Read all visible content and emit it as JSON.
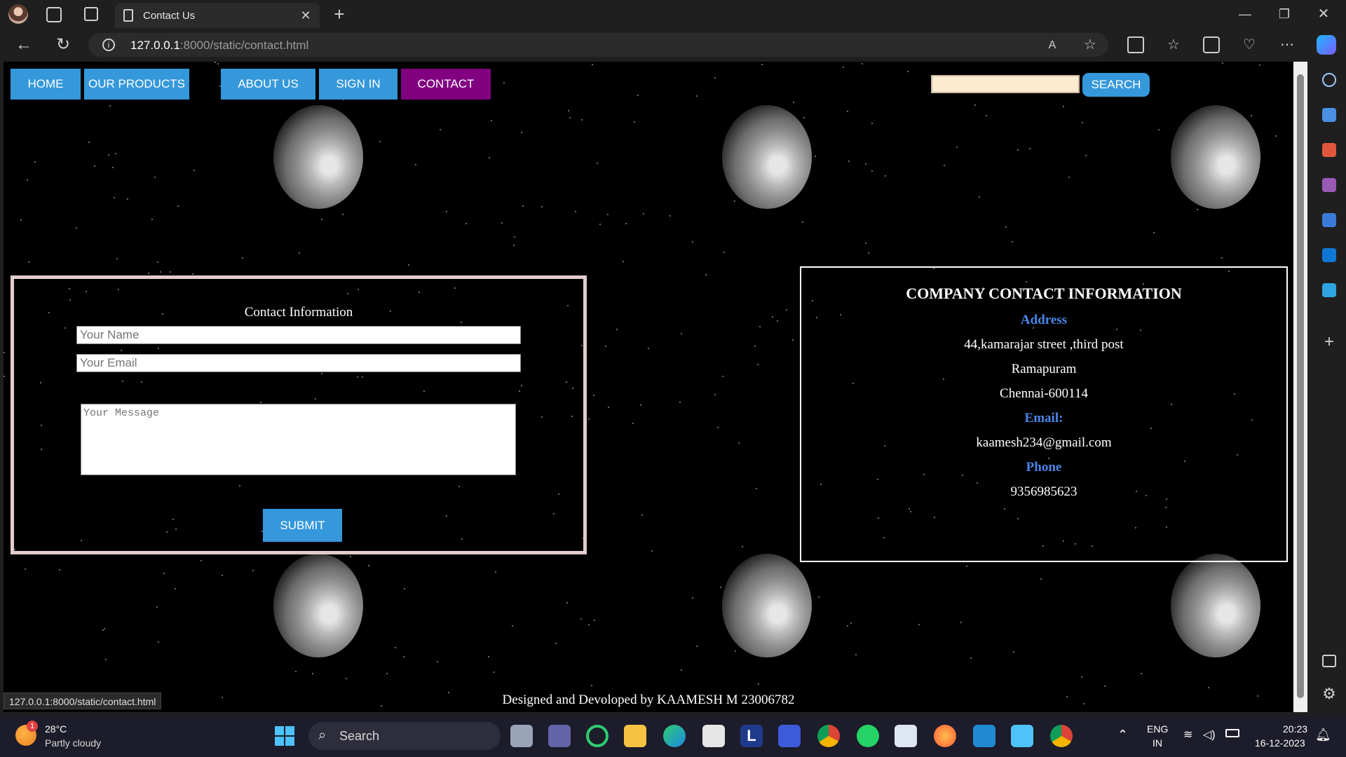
{
  "browser": {
    "tab_title": "Contact Us",
    "url_host": "127.0.0.1",
    "url_path": ":8000/static/contact.html",
    "status_url": "127.0.0.1:8000/static/contact.html"
  },
  "nav": {
    "items": [
      "HOME",
      "OUR PRODUCTS",
      "ABOUT US",
      "SIGN IN",
      "CONTACT"
    ],
    "active": "CONTACT",
    "search_label": "SEARCH"
  },
  "form": {
    "title": "Contact Information",
    "name_placeholder": "Your Name",
    "email_placeholder": "Your Email",
    "message_placeholder": "Your Message",
    "submit_label": "SUBMIT"
  },
  "company": {
    "title": "COMPANY CONTACT INFORMATION",
    "address_label": "Address",
    "address_line1": "44,kamarajar street ,third post",
    "address_line2": "Ramapuram",
    "address_line3": "Chennai-600114",
    "email_label": "Email:",
    "email": "kaamesh234@gmail.com",
    "phone_label": "Phone",
    "phone": "9356985623"
  },
  "footer": {
    "credit": "Designed and Devoloped by KAAMESH M 23006782"
  },
  "taskbar": {
    "weather_temp": "28°C",
    "weather_desc": "Partly cloudy",
    "weather_badge": "1",
    "search_label": "Search",
    "lang_line1": "ENG",
    "lang_line2": "IN",
    "time": "20:23",
    "date": "16-12-2023"
  },
  "colors": {
    "nav_button": "#3498db",
    "nav_active": "#800080",
    "search_field": "#fdebd0",
    "label_blue": "#4a86e8",
    "form_border": "#e3cccc"
  }
}
